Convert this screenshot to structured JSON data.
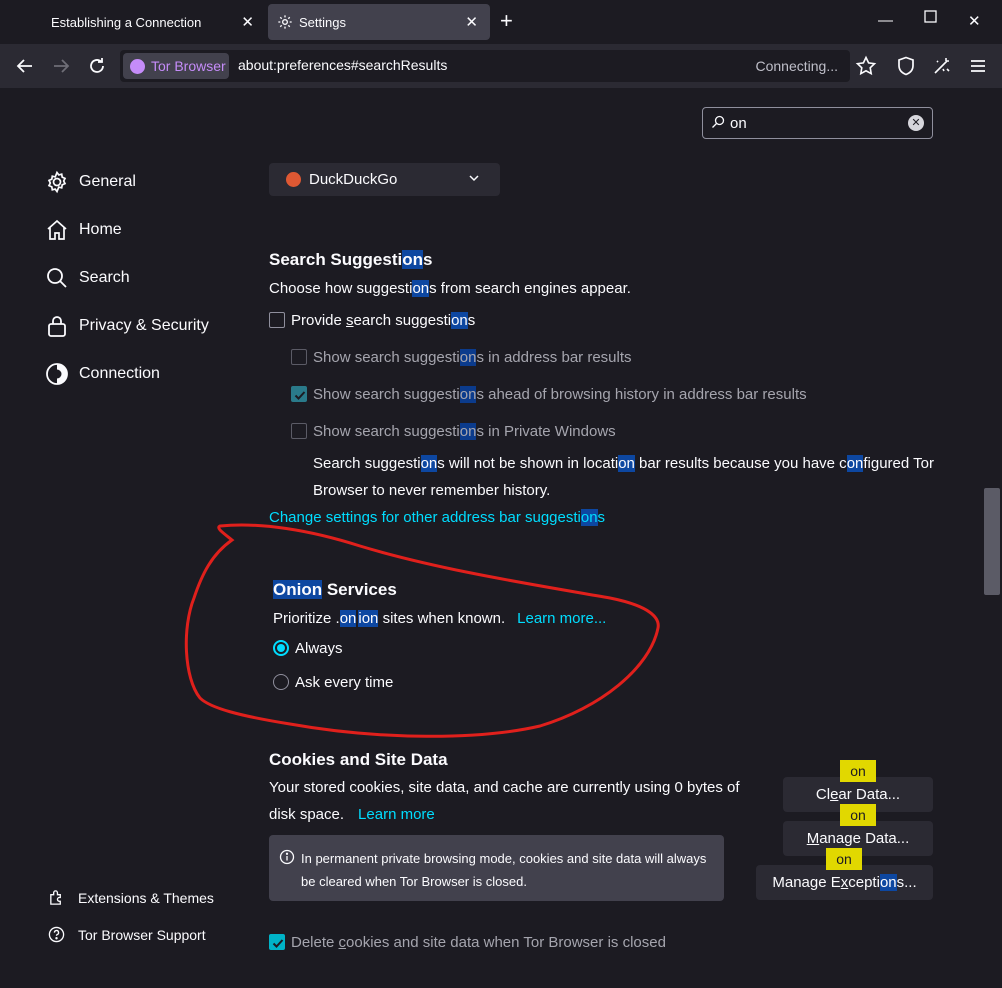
{
  "tabs": [
    {
      "label": "Establishing a Connection"
    },
    {
      "label": "Settings"
    }
  ],
  "navbar": {
    "identity_label": "Tor Browser",
    "url": "about:preferences#searchResults",
    "status": "Connecting..."
  },
  "search": {
    "value": "on"
  },
  "sidebar": {
    "items": [
      {
        "label": "General",
        "icon": "gear-icon"
      },
      {
        "label": "Home",
        "icon": "home-icon"
      },
      {
        "label": "Search",
        "icon": "search-icon"
      },
      {
        "label": "Privacy & Security",
        "icon": "lock-icon"
      },
      {
        "label": "Connection",
        "icon": "connection-icon"
      }
    ],
    "footer": [
      {
        "label": "Extensions & Themes",
        "icon": "puzzle-icon"
      },
      {
        "label": "Tor Browser Support",
        "icon": "help-icon"
      }
    ]
  },
  "engine": {
    "selected": "DuckDuckGo"
  },
  "suggestions": {
    "title_a": "Search Suggesti",
    "title_hl": "on",
    "title_b": "s",
    "desc_a": "Choose how suggesti",
    "desc_hl": "on",
    "desc_b": "s from search engines appear.",
    "provide": {
      "a": "Provide ",
      "u": "s",
      "b": "earch suggesti",
      "hl": "on",
      "c": "s",
      "checked": false
    },
    "opt1": {
      "a": "Show search suggesti",
      "hl": "on",
      "b": "s in address bar results",
      "checked": false
    },
    "opt2": {
      "a": "Show search suggesti",
      "hl": "on",
      "b": "s ahead of browsing history in address bar results",
      "checked": true
    },
    "opt3": {
      "a": "Show search suggesti",
      "hl": "on",
      "b": "s in Private Windows",
      "checked": false
    },
    "note_1a": "Search suggesti",
    "note_1hl": "on",
    "note_1b": "s will not be shown in locati",
    "note_1hl2": "on",
    "note_1c": " bar results because you have c",
    "note_1hl3": "on",
    "note_1d": "figured Tor",
    "note_2": "Browser to never remember history.",
    "change_a": "Change settings for other address bar suggesti",
    "change_hl": "on",
    "change_b": "s"
  },
  "onion": {
    "title_hl": "Onion",
    "title_b": " Services",
    "desc_a": "Prioritize .",
    "desc_hl1": "on",
    "desc_hl2": "ion",
    "desc_b": " sites when known.",
    "learn_more": "Learn more...",
    "radio_always": "Always",
    "radio_ask": "Ask every time",
    "selected": "Always"
  },
  "cookies": {
    "title": "Cookies and Site Data",
    "desc_1": "Your stored cookies, site data, and cache are currently using 0 bytes of",
    "desc_2": "disk space.",
    "learn_more": "Learn more",
    "info": "In permanent private browsing mode, cookies and site data will always be cleared when Tor Browser is closed.",
    "delete": {
      "a": "Delete ",
      "u": "c",
      "b": "ookies and site data when Tor Browser is closed",
      "checked": true
    },
    "btn_clear": {
      "a": "Cl",
      "u": "e",
      "b": "ar Data..."
    },
    "btn_manage": {
      "a": "",
      "u": "M",
      "b": "anage Data..."
    },
    "btn_exceptions": {
      "a": "Manage E",
      "u": "x",
      "b": "cepti",
      "hl": "on",
      "c": "s..."
    },
    "tag": "on"
  },
  "colors": {
    "accent": "#00ddff",
    "annotation": "#e0201c",
    "highlight": "#0d47a1",
    "tag": "#e1d800"
  }
}
